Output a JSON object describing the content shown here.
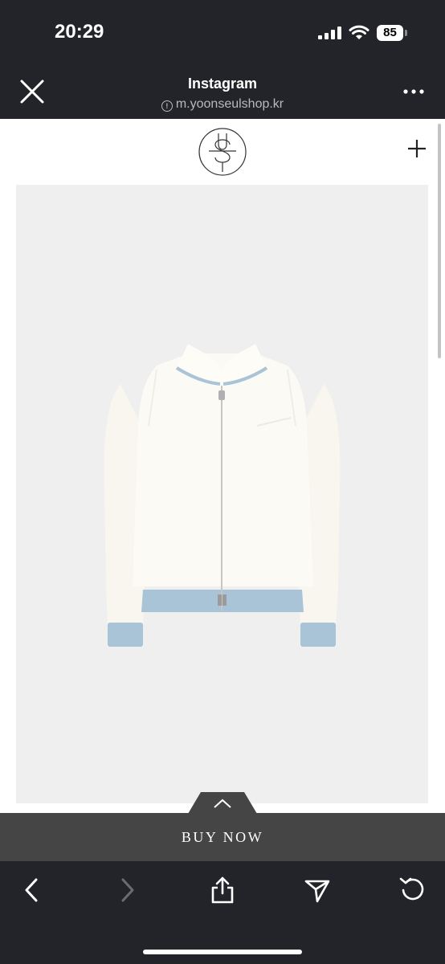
{
  "status_bar": {
    "time": "20:29",
    "battery_level": "85"
  },
  "browser": {
    "title": "Instagram",
    "url": "m.yoonseulshop.kr"
  },
  "page": {
    "cta_label": "BUY NOW"
  },
  "colors": {
    "chrome": "#222429",
    "cta_bar": "#454545",
    "image_bg": "#efefef",
    "trim_blue": "#a9c4d6"
  }
}
